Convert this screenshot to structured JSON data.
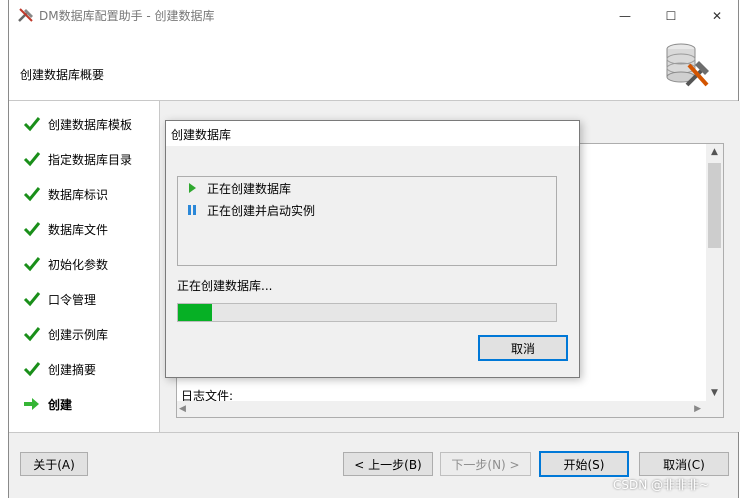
{
  "window": {
    "title": "DM数据库配置助手 - 创建数据库",
    "minimize": "—",
    "maximize": "☐",
    "close": "✕"
  },
  "header": {
    "title": "创建数据库概要",
    "logo_icon": "database-tools-icon"
  },
  "sidebar": {
    "items": [
      {
        "label": "创建数据库模板",
        "icon": "check-icon",
        "state": "done"
      },
      {
        "label": "指定数据库目录",
        "icon": "check-icon",
        "state": "done"
      },
      {
        "label": "数据库标识",
        "icon": "check-icon",
        "state": "done"
      },
      {
        "label": "数据库文件",
        "icon": "check-icon",
        "state": "done"
      },
      {
        "label": "初始化参数",
        "icon": "check-icon",
        "state": "done"
      },
      {
        "label": "口令管理",
        "icon": "check-icon",
        "state": "done"
      },
      {
        "label": "创建示例库",
        "icon": "check-icon",
        "state": "done"
      },
      {
        "label": "创建摘要",
        "icon": "check-icon",
        "state": "done"
      },
      {
        "label": "创建",
        "icon": "arrow-right-icon",
        "state": "current"
      }
    ]
  },
  "content": {
    "log_label": "日志文件:"
  },
  "buttons": {
    "about": "关于(A)",
    "prev": "< 上一步(B)",
    "next": "下一步(N) >",
    "start": "开始(S)",
    "cancel": "取消(C)"
  },
  "dialog": {
    "title": "创建数据库",
    "tasks": [
      {
        "label": "正在创建数据库",
        "icon": "play-icon",
        "state": "running"
      },
      {
        "label": "正在创建并启动实例",
        "icon": "pause-icon",
        "state": "pending"
      }
    ],
    "status": "正在创建数据库...",
    "progress": 0.09,
    "cancel": "取消"
  },
  "watermark": "CSDN @非非非~",
  "colors": {
    "check": "#1a8f1a",
    "progress": "#06b025",
    "focus_border": "#0078d7",
    "arrow": "#35b535"
  }
}
